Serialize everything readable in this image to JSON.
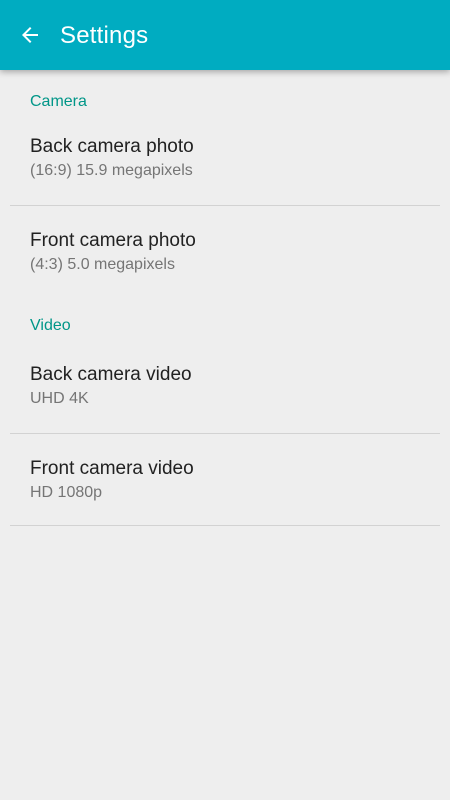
{
  "app_bar": {
    "title": "Settings",
    "back_icon": "arrow-back-icon",
    "color": "#00acc1"
  },
  "sections": [
    {
      "header": "Camera",
      "items": [
        {
          "title": "Back camera photo",
          "summary": "(16:9) 15.9 megapixels"
        },
        {
          "title": "Front camera photo",
          "summary": "(4:3) 5.0 megapixels"
        }
      ]
    },
    {
      "header": "Video",
      "items": [
        {
          "title": "Back camera video",
          "summary": "UHD 4K"
        },
        {
          "title": "Front camera video",
          "summary": "HD 1080p"
        }
      ]
    }
  ],
  "colors": {
    "accent": "#009688",
    "background": "#eeeeee"
  }
}
